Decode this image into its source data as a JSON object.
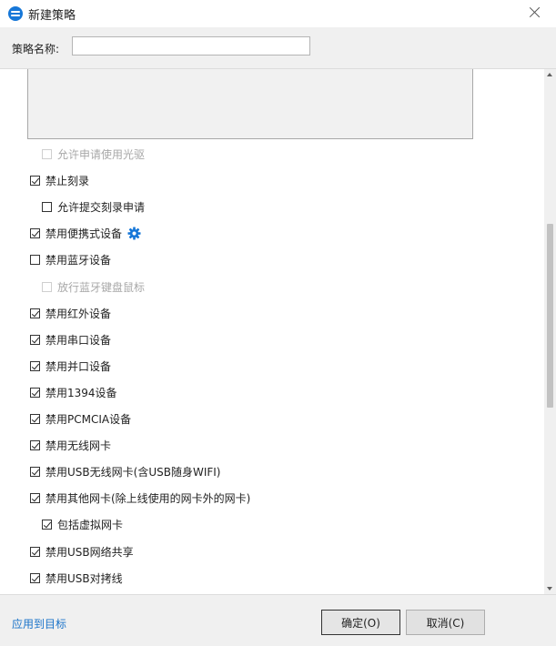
{
  "window": {
    "title": "新建策略",
    "close_icon": "close-icon",
    "app_icon": "app-logo-icon",
    "accent_color": "#1677d8"
  },
  "header": {
    "name_label": "策略名称:",
    "name_value": "",
    "name_placeholder": ""
  },
  "options": [
    {
      "label": "允许申请使用光驱",
      "checked": false,
      "disabled": true,
      "indent": 1
    },
    {
      "label": "禁止刻录",
      "checked": true,
      "disabled": false,
      "indent": 0
    },
    {
      "label": "允许提交刻录申请",
      "checked": false,
      "disabled": false,
      "indent": 1
    },
    {
      "label": "禁用便携式设备",
      "checked": true,
      "disabled": false,
      "indent": 0,
      "icon": "gear-icon"
    },
    {
      "label": "禁用蓝牙设备",
      "checked": false,
      "disabled": false,
      "indent": 0
    },
    {
      "label": "放行蓝牙键盘鼠标",
      "checked": false,
      "disabled": true,
      "indent": 1
    },
    {
      "label": "禁用红外设备",
      "checked": true,
      "disabled": false,
      "indent": 0
    },
    {
      "label": "禁用串口设备",
      "checked": true,
      "disabled": false,
      "indent": 0
    },
    {
      "label": "禁用并口设备",
      "checked": true,
      "disabled": false,
      "indent": 0
    },
    {
      "label": "禁用1394设备",
      "checked": true,
      "disabled": false,
      "indent": 0
    },
    {
      "label": "禁用PCMCIA设备",
      "checked": true,
      "disabled": false,
      "indent": 0
    },
    {
      "label": "禁用无线网卡",
      "checked": true,
      "disabled": false,
      "indent": 0
    },
    {
      "label": "禁用USB无线网卡(含USB随身WIFI)",
      "checked": true,
      "disabled": false,
      "indent": 0
    },
    {
      "label": "禁用其他网卡(除上线使用的网卡外的网卡)",
      "checked": true,
      "disabled": false,
      "indent": 0
    },
    {
      "label": "包括虚拟网卡",
      "checked": true,
      "disabled": false,
      "indent": 1
    },
    {
      "label": "禁用USB网络共享",
      "checked": true,
      "disabled": false,
      "indent": 0
    },
    {
      "label": "禁用USB对拷线",
      "checked": true,
      "disabled": false,
      "indent": 0
    }
  ],
  "footer": {
    "apply_link": "应用到目标",
    "ok_label": "确定(O)",
    "cancel_label": "取消(C)",
    "link_color": "#1a73c9"
  }
}
